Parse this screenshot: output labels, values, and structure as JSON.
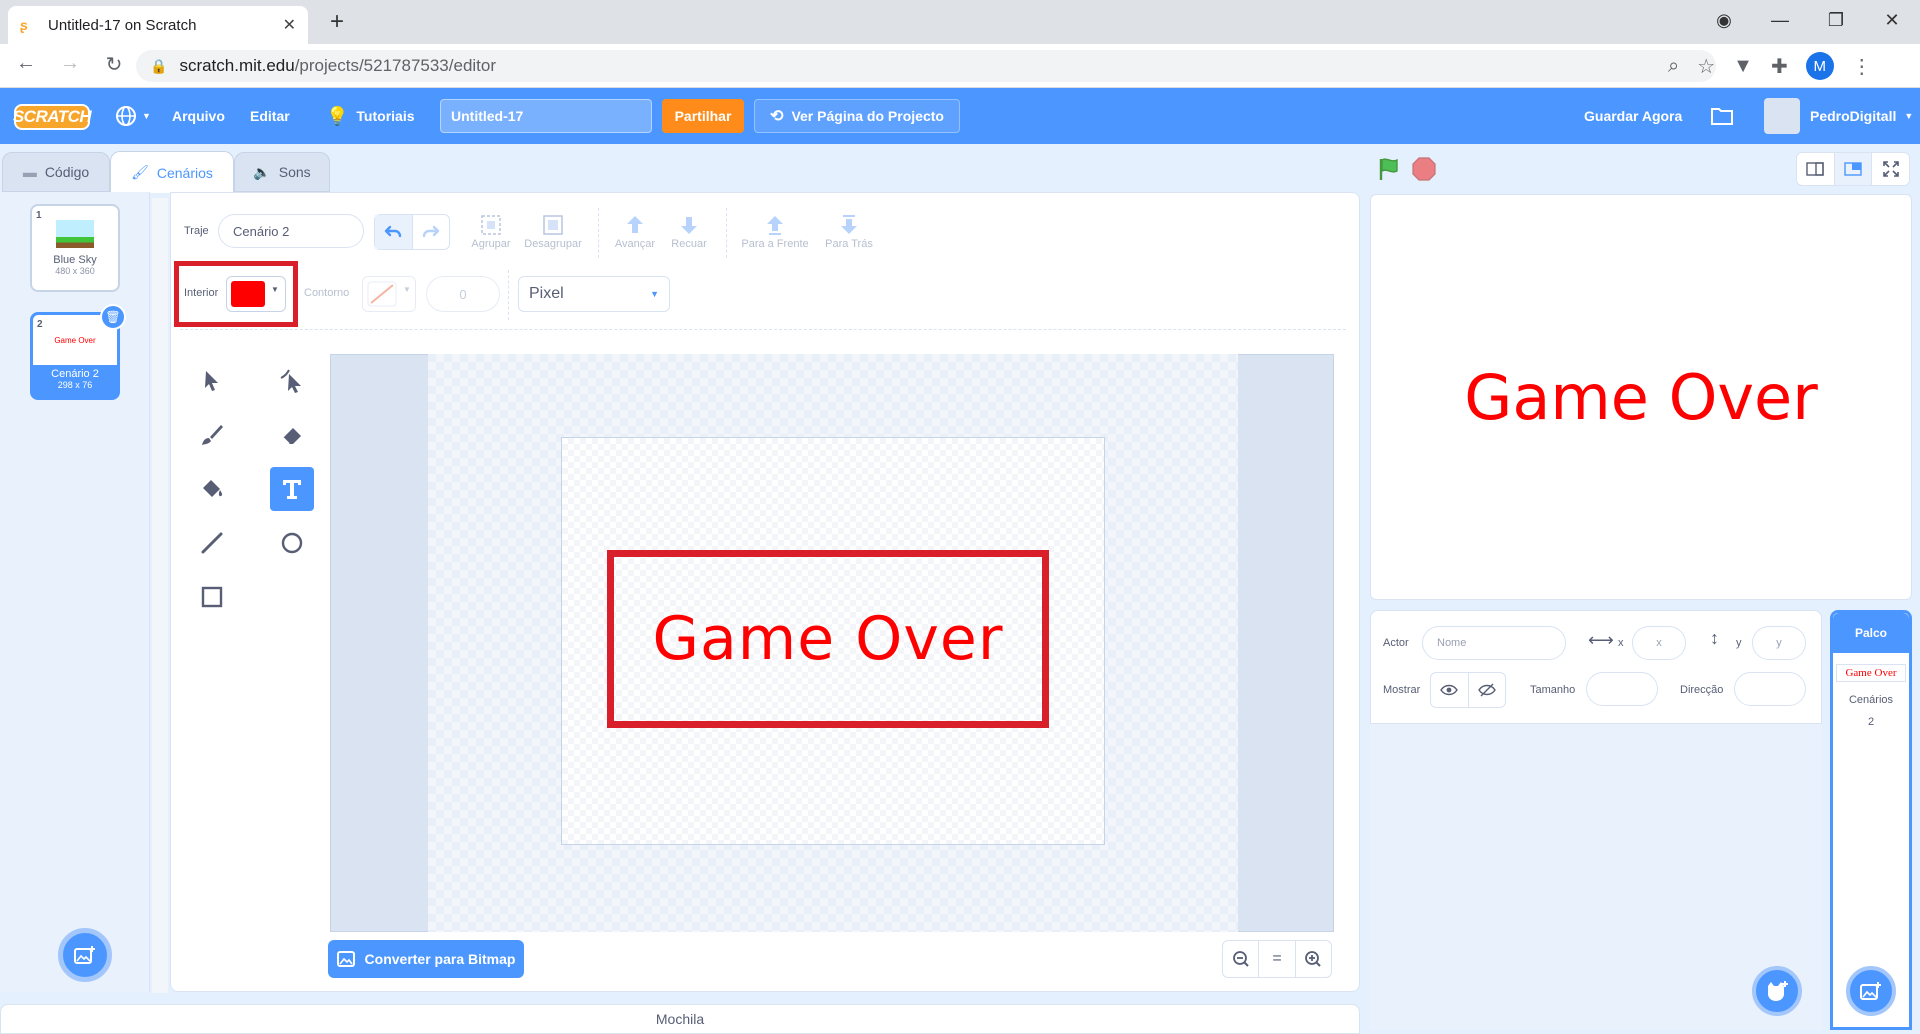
{
  "browser": {
    "tab_title": "Untitled-17 on Scratch",
    "url_host": "scratch.mit.edu",
    "url_path": "/projects/521787533/editor",
    "profile_initial": "M"
  },
  "menu": {
    "logo": "SCRATCH",
    "file": "Arquivo",
    "edit": "Editar",
    "tutorials": "Tutoriais",
    "project_title": "Untitled-17",
    "share": "Partilhar",
    "view_page": "Ver Página do Projecto",
    "save_now": "Guardar Agora",
    "username": "PedroDigitall"
  },
  "tabs": {
    "code": "Código",
    "costumes": "Cenários",
    "sounds": "Sons"
  },
  "costumes": [
    {
      "num": "1",
      "name": "Blue Sky",
      "size": "480 x 360"
    },
    {
      "num": "2",
      "name": "Cenário 2",
      "size": "298 x 76",
      "thumb_text": "Game Over"
    }
  ],
  "paint": {
    "costume_label": "Traje",
    "costume_name": "Cenário 2",
    "group": "Agrupar",
    "ungroup": "Desagrupar",
    "forward": "Avançar",
    "backward": "Recuar",
    "front": "Para a Frente",
    "back": "Para Trás",
    "fill_label": "Interior",
    "fill_color": "#ff0000",
    "outline_label": "Contorno",
    "outline_width": "0",
    "font": "Pixel",
    "canvas_text": "Game Over",
    "convert_bitmap": "Converter para Bitmap",
    "zoom_reset": "="
  },
  "backpack": "Mochila",
  "stage": {
    "text": "Game Over"
  },
  "sprite_info": {
    "sprite_label": "Actor",
    "name_placeholder": "Nome",
    "x_label": "x",
    "x_placeholder": "x",
    "y_label": "y",
    "y_placeholder": "y",
    "show_label": "Mostrar",
    "size_label": "Tamanho",
    "direction_label": "Direcção"
  },
  "stage_panel": {
    "title": "Palco",
    "thumb_text": "Game Over",
    "backdrops_label": "Cenários",
    "backdrops_count": "2"
  },
  "colors": {
    "scratch_blue": "#4c97ff",
    "share_orange": "#ff8c1a",
    "highlight_red": "#d9202a",
    "text_red": "#ff0000"
  }
}
